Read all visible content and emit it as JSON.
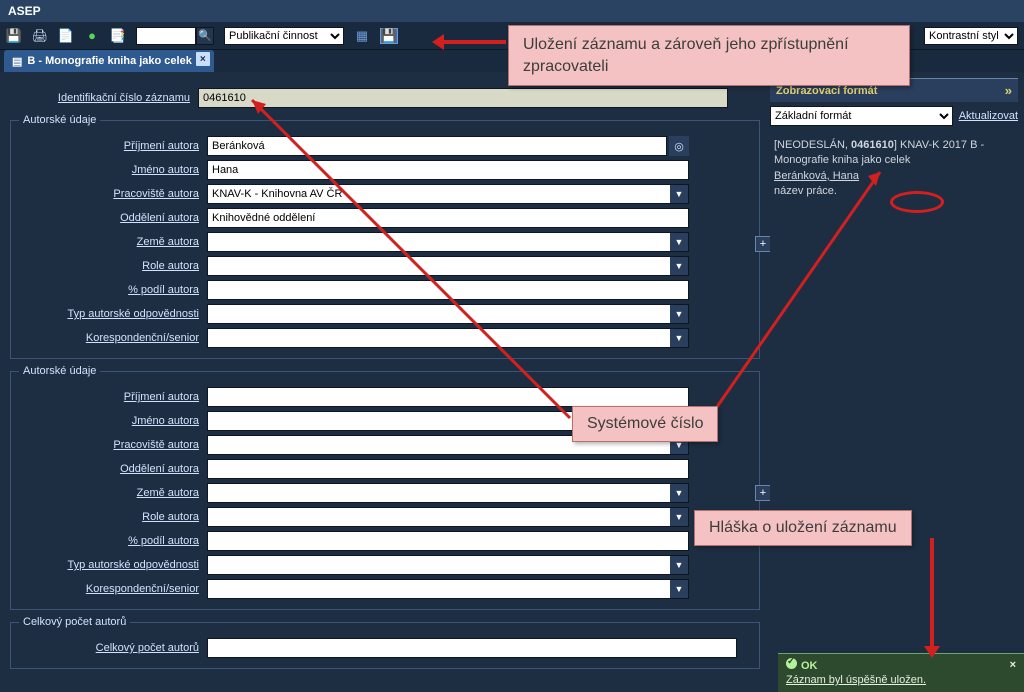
{
  "app": {
    "title": "ASEP"
  },
  "toolbar": {
    "search_value": "",
    "activity_select": "Publikační činnost",
    "contrast_select": "Kontrastní styl"
  },
  "callouts": {
    "save": "Uložení záznamu a zároveň jeho zpřístupnění zpracovateli",
    "sysnum": "Systémové číslo",
    "okmsg": "Hláška o uložení záznamu"
  },
  "tab": {
    "label": "B - Monografie kniha jako celek"
  },
  "form": {
    "id_label": "Identifikační číslo záznamu",
    "id_value": "0461610",
    "group_author": "Autorské údaje",
    "group_total": "Celkový počet autorů",
    "labels": {
      "surname": "Příjmení autora",
      "firstname": "Jméno autora",
      "workplace": "Pracoviště autora",
      "department": "Oddělení autora",
      "country": "Země autora",
      "role": "Role autora",
      "share": "% podíl autora",
      "resp": "Typ autorské odpovědnosti",
      "corr": "Korespondenční/senior",
      "total": "Celkový počet autorů"
    },
    "values": {
      "surname": "Beránková",
      "firstname": "Hana",
      "workplace": "KNAV-K - Knihovna AV ČR",
      "department": "Knihovědné oddělení",
      "country": "",
      "role": "",
      "share": "",
      "resp": "",
      "corr": "",
      "total": ""
    }
  },
  "side": {
    "panel_title": "Zobrazovací formát",
    "format_select": "Základní formát",
    "refresh": "Aktualizovat",
    "preview": {
      "status": "[NEODESLÁN,",
      "sysnum": "0461610",
      "tail": "KNAV-K 2017 B - Monografie kniha jako celek",
      "author": "Beránková, Hana",
      "title": "název práce."
    }
  },
  "toast": {
    "ok": "OK",
    "msg": "Záznam byl úspěšně uložen."
  }
}
